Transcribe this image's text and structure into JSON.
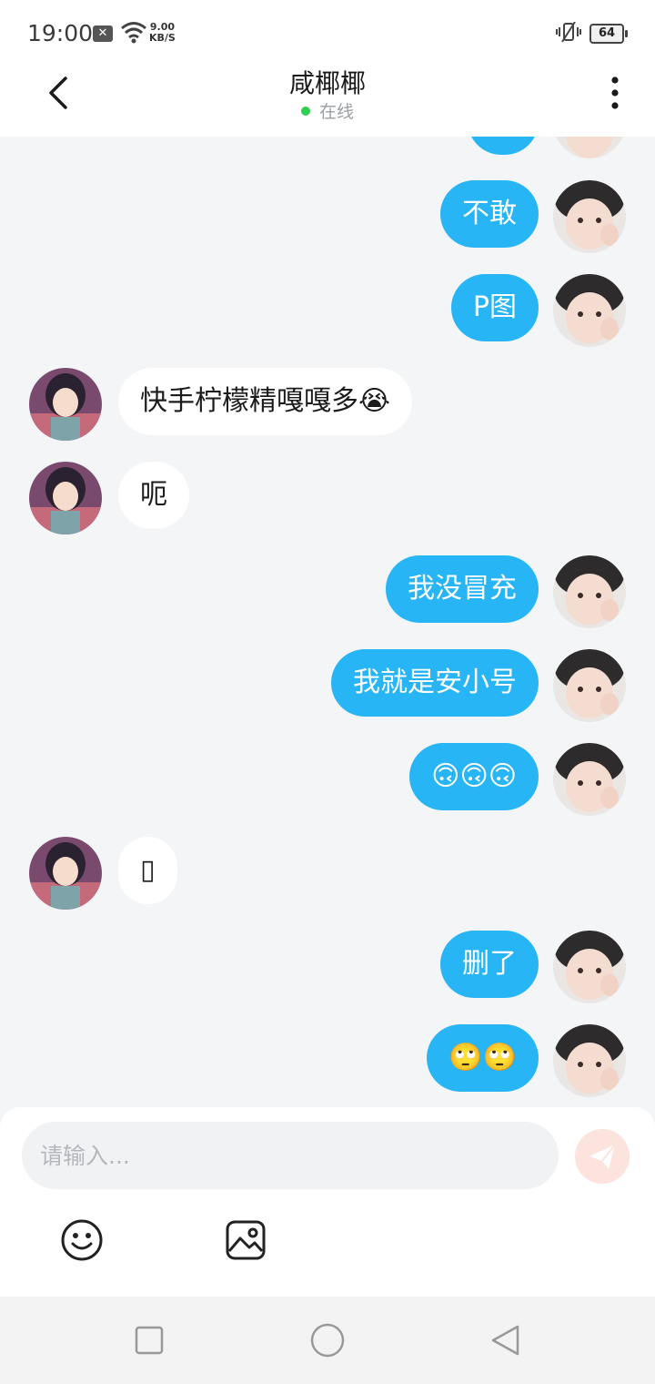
{
  "status_bar": {
    "time": "19:00",
    "x_badge": "✕",
    "net_speed_value": "9.00",
    "net_speed_unit": "KB/S",
    "battery": "64"
  },
  "header": {
    "title": "咸椰椰",
    "status": "在线",
    "status_color": "#2fcf4f"
  },
  "messages": [
    {
      "side": "out",
      "text": "不敢"
    },
    {
      "side": "out",
      "text": "P图"
    },
    {
      "side": "in",
      "text": "快手柠檬精嘎嘎多😭"
    },
    {
      "side": "in",
      "text": "呃"
    },
    {
      "side": "out",
      "text": "我没冒充"
    },
    {
      "side": "out",
      "text": "我就是安小号"
    },
    {
      "side": "out",
      "text": "🙃🙃🙃"
    },
    {
      "side": "in",
      "text": "▯"
    },
    {
      "side": "out",
      "text": "删了"
    },
    {
      "side": "out",
      "text": "🙄🙄"
    }
  ],
  "composer": {
    "placeholder": "请输入..."
  },
  "colors": {
    "outgoing_bubble": "#27b5f5",
    "incoming_bubble": "#ffffff",
    "chat_background": "#f3f5f7"
  }
}
